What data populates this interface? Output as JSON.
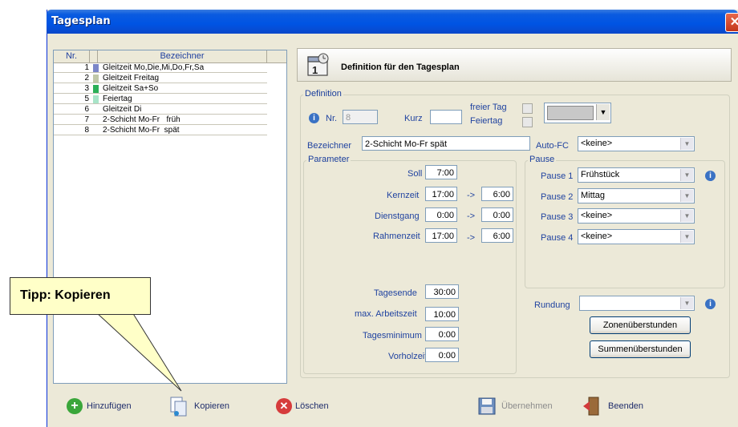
{
  "window": {
    "title": "Tagesplan",
    "close_glyph": "✕"
  },
  "list": {
    "headers": {
      "nr": "Nr.",
      "name": "Bezeichner"
    },
    "rows": [
      {
        "nr": "1",
        "name": "Gleitzeit Mo,Die,Mi,Do,Fr,Sa",
        "color": "#7b86c8"
      },
      {
        "nr": "2",
        "name": "Gleitzeit Freitag",
        "color": "#c0c8a8"
      },
      {
        "nr": "3",
        "name": "Gleitzeit Sa+So",
        "color": "#2bb058"
      },
      {
        "nr": "5",
        "name": "Feiertag",
        "color": "#a8e4c8"
      },
      {
        "nr": "6",
        "name": "Gleitzeit Di",
        "color": ""
      },
      {
        "nr": "7",
        "name": "2-Schicht Mo-Fr   früh",
        "color": ""
      },
      {
        "nr": "8",
        "name": "2-Schicht Mo-Fr  spät",
        "color": ""
      }
    ]
  },
  "banner": {
    "title": "Definition für den Tagesplan",
    "icon": "calendar-icon"
  },
  "definition": {
    "group_label": "Definition",
    "nr_label": "Nr.",
    "nr_value": "8",
    "kurz_label": "Kurz",
    "kurz_value": "",
    "freier_tag_label": "freier Tag",
    "feiertag_label": "Feiertag",
    "bezeichner_label": "Bezeichner",
    "bezeichner_value": "2-Schicht Mo-Fr  spät",
    "autofc_label": "Auto-FC",
    "autofc_value": "<keine>"
  },
  "parameter": {
    "group_label": "Parameter",
    "soll_label": "Soll",
    "soll_value": "7:00",
    "kernzeit_label": "Kernzeit",
    "kernzeit_from": "17:00",
    "kernzeit_to": "6:00",
    "dienstgang_label": "Dienstgang",
    "dienstgang_from": "0:00",
    "dienstgang_to": "0:00",
    "rahmenzeit_label": "Rahmenzeit",
    "rahmenzeit_from": "17:00",
    "rahmenzeit_to": "6:00",
    "arrow": "->",
    "tagesende_label": "Tagesende",
    "tagesende_value": "30:00",
    "max_arbeitszeit_label": "max. Arbeitszeit",
    "max_arbeitszeit_value": "10:00",
    "tagesminimum_label": "Tagesminimum",
    "tagesminimum_value": "0:00",
    "vorholzeit_label": "Vorholzeit",
    "vorholzeit_value": "0:00"
  },
  "pause": {
    "group_label": "Pause",
    "items": [
      {
        "label": "Pause 1",
        "value": "Frühstück"
      },
      {
        "label": "Pause 2",
        "value": "Mittag"
      },
      {
        "label": "Pause 3",
        "value": "<keine>"
      },
      {
        "label": "Pause 4",
        "value": "<keine>"
      }
    ]
  },
  "rundung": {
    "label": "Rundung",
    "value": "",
    "zonen_button": "Zonenüberstunden",
    "summen_button": "Summenüberstunden"
  },
  "toolbar": {
    "add": "Hinzufügen",
    "copy": "Kopieren",
    "delete": "Löschen",
    "apply": "Übernehmen",
    "exit": "Beenden"
  },
  "callout": {
    "text": "Tipp: Kopieren"
  },
  "colors": {
    "accent": "#0054e3",
    "label_blue": "#2043a0",
    "callout_bg": "#ffffc8"
  }
}
